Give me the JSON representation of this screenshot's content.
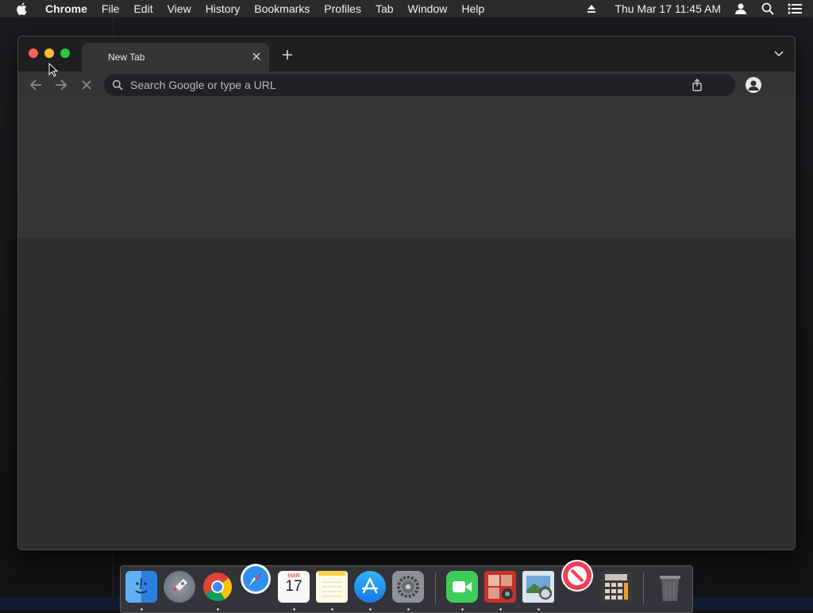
{
  "menubar": {
    "app_name": "Chrome",
    "items": [
      "File",
      "Edit",
      "View",
      "History",
      "Bookmarks",
      "Profiles",
      "Tab",
      "Window",
      "Help"
    ],
    "clock": "Thu Mar 17  11:45 AM"
  },
  "browser": {
    "tab_title": "New Tab",
    "omnibox_placeholder": "Search Google or type a URL"
  },
  "dock": {
    "apps": [
      "finder-icon",
      "launchpad-icon",
      "chrome-icon",
      "safari-icon",
      "calendar-icon",
      "notes-icon",
      "app-store-icon",
      "system-preferences-icon",
      "facetime-icon",
      "photo-booth-icon",
      "preview-icon",
      "news-icon",
      "calculator-icon",
      "trash-icon"
    ],
    "calendar_month": "MAR",
    "calendar_day": "17"
  },
  "colors": {
    "menubar_bg": "#2b2b2d",
    "window_bg": "#2f2f31",
    "traffic_red": "#fe5f57",
    "traffic_yellow": "#febc2e",
    "traffic_green": "#28c840"
  }
}
